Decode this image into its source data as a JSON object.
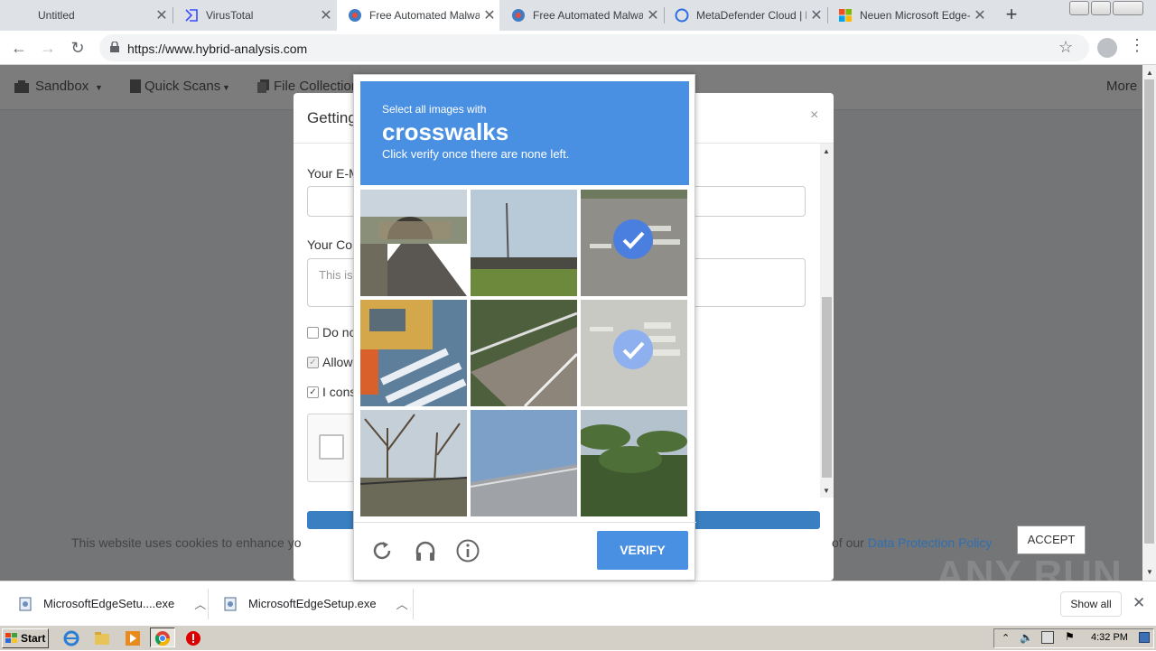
{
  "browser": {
    "tabs": [
      {
        "title": "Untitled",
        "favicon": "blank-icon"
      },
      {
        "title": "VirusTotal",
        "favicon": "virustotal-icon"
      },
      {
        "title": "Free Automated Malware",
        "favicon": "hybrid-analysis-icon"
      },
      {
        "title": "Free Automated Malware",
        "favicon": "hybrid-analysis-icon"
      },
      {
        "title": "MetaDefender Cloud | R",
        "favicon": "metadefender-icon"
      },
      {
        "title": "Neuen Microsoft Edge-B",
        "favicon": "microsoft-icon"
      }
    ],
    "url": "https://www.hybrid-analysis.com"
  },
  "site_nav": {
    "items": [
      "Sandbox",
      "Quick Scans",
      "File Collection"
    ],
    "more": "More"
  },
  "modal": {
    "title": "Getting",
    "label_email": "Your E-M",
    "label_comment": "Your Cor",
    "comment_placeholder": "This is",
    "check1": "Do no",
    "check2": "Allow",
    "check3": "I cons"
  },
  "cookie": {
    "text": "This website uses cookies to enhance yo",
    "text_end": "of our",
    "link": "Data Protection Policy",
    "accept": "ACCEPT"
  },
  "captcha": {
    "line1": "Select all images with",
    "keyword": "crosswalks",
    "line3": "Click verify once there are none left.",
    "verify": "VERIFY",
    "selected_tiles": [
      3,
      6
    ]
  },
  "downloads": {
    "items": [
      "MicrosoftEdgeSetu....exe",
      "MicrosoftEdgeSetup.exe"
    ],
    "show_all": "Show all"
  },
  "taskbar": {
    "start": "Start",
    "clock": "4:32 PM"
  },
  "watermark": "ANY RUN",
  "colors": {
    "captcha_blue": "#4a90e2",
    "link_blue": "#2f6fb0"
  }
}
